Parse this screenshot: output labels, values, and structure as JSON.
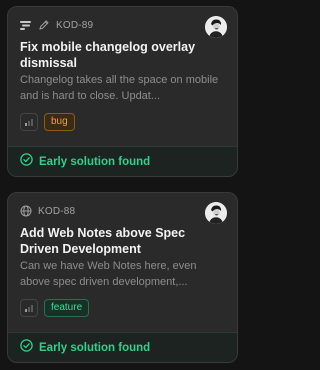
{
  "cards": [
    {
      "id": "KOD-89",
      "title": "Fix mobile changelog overlay dismissal",
      "description": "Changelog takes all the space on mobile and is hard to close. Updat...",
      "tag": "bug",
      "status": "Early solution found",
      "icons": [
        "bars-icon",
        "pencil-icon"
      ]
    },
    {
      "id": "KOD-88",
      "title": "Add Web Notes above Spec Driven Development",
      "description": "Can we have Web Notes here, even above spec driven development,...",
      "tag": "feature",
      "status": "Early solution found",
      "icons": [
        "globe-icon"
      ]
    }
  ],
  "colors": {
    "bug": "#f0a043",
    "feature": "#3ddc97",
    "status_green": "#2fd18b",
    "card_bg": "#2a2a2b"
  }
}
